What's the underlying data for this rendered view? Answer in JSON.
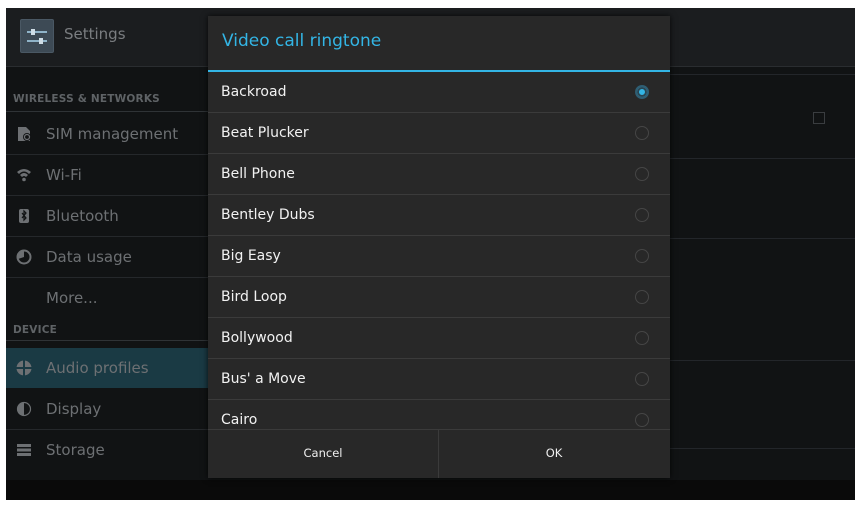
{
  "app": {
    "title": "Settings"
  },
  "sidebar": {
    "sections": [
      {
        "header": "WIRELESS & NETWORKS"
      },
      {
        "header": "DEVICE"
      }
    ],
    "items": [
      {
        "label": "SIM management",
        "icon": "sim-icon"
      },
      {
        "label": "Wi-Fi",
        "icon": "wifi-icon"
      },
      {
        "label": "Bluetooth",
        "icon": "bluetooth-icon"
      },
      {
        "label": "Data usage",
        "icon": "data-usage-icon"
      },
      {
        "label": "More...",
        "icon": ""
      },
      {
        "label": "Audio profiles",
        "icon": "audio-profiles-icon",
        "active": true
      },
      {
        "label": "Display",
        "icon": "display-icon"
      },
      {
        "label": "Storage",
        "icon": "storage-icon"
      }
    ]
  },
  "dialog": {
    "title": "Video call ringtone",
    "options": [
      {
        "label": "Backroad",
        "selected": true
      },
      {
        "label": "Beat Plucker",
        "selected": false
      },
      {
        "label": "Bell Phone",
        "selected": false
      },
      {
        "label": "Bentley Dubs",
        "selected": false
      },
      {
        "label": "Big Easy",
        "selected": false
      },
      {
        "label": "Bird Loop",
        "selected": false
      },
      {
        "label": "Bollywood",
        "selected": false
      },
      {
        "label": "Bus' a Move",
        "selected": false
      },
      {
        "label": "Cairo",
        "selected": false
      }
    ],
    "cancel_label": "Cancel",
    "ok_label": "OK"
  },
  "colors": {
    "accent": "#33b5e5",
    "dialog_bg": "#282828",
    "screen_bg": "#111314"
  }
}
